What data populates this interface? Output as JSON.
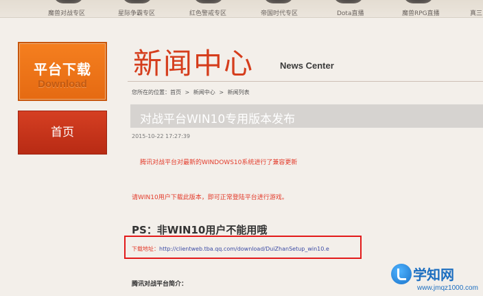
{
  "top_nav": {
    "items": [
      "魔兽对战专区",
      "星际争霸专区",
      "红色警戒专区",
      "帝国时代专区",
      "Dota直播",
      "魔兽RPG直播",
      "真三"
    ]
  },
  "sidebar": {
    "download_cn": "平台下载",
    "download_en": "Download",
    "home": "首页"
  },
  "main": {
    "title_cn": "新闻中心",
    "title_en": "News Center",
    "breadcrumb": [
      "您所在的位置：首页",
      ">",
      "新闻中心",
      ">",
      "新闻列表"
    ],
    "article_title": "对战平台WIN10专用版本发布",
    "date": "2015-10-22 17:27:39",
    "para1": "腾讯对战平台对最新的WINDOWS10系统进行了兼容更新",
    "para2": "请WIN10用户下载此版本，即可正常登陆平台进行游戏。",
    "ps_heading": "PS：非WIN10用户不能用哦",
    "download_label": "下载地址：",
    "download_url": "http://clientweb.tba.qq.com/download/DuiZhanSetup_win10.e",
    "intro_label": "腾讯对战平台简介："
  },
  "watermark": {
    "title": "学知网",
    "url": "www.jmqz1000.com"
  },
  "colors": {
    "accent_orange": "#e56a12",
    "accent_red": "#c12f17",
    "news_red": "#d53d1c",
    "highlight_box": "#e21818",
    "link_blue": "#3a4aa4"
  }
}
